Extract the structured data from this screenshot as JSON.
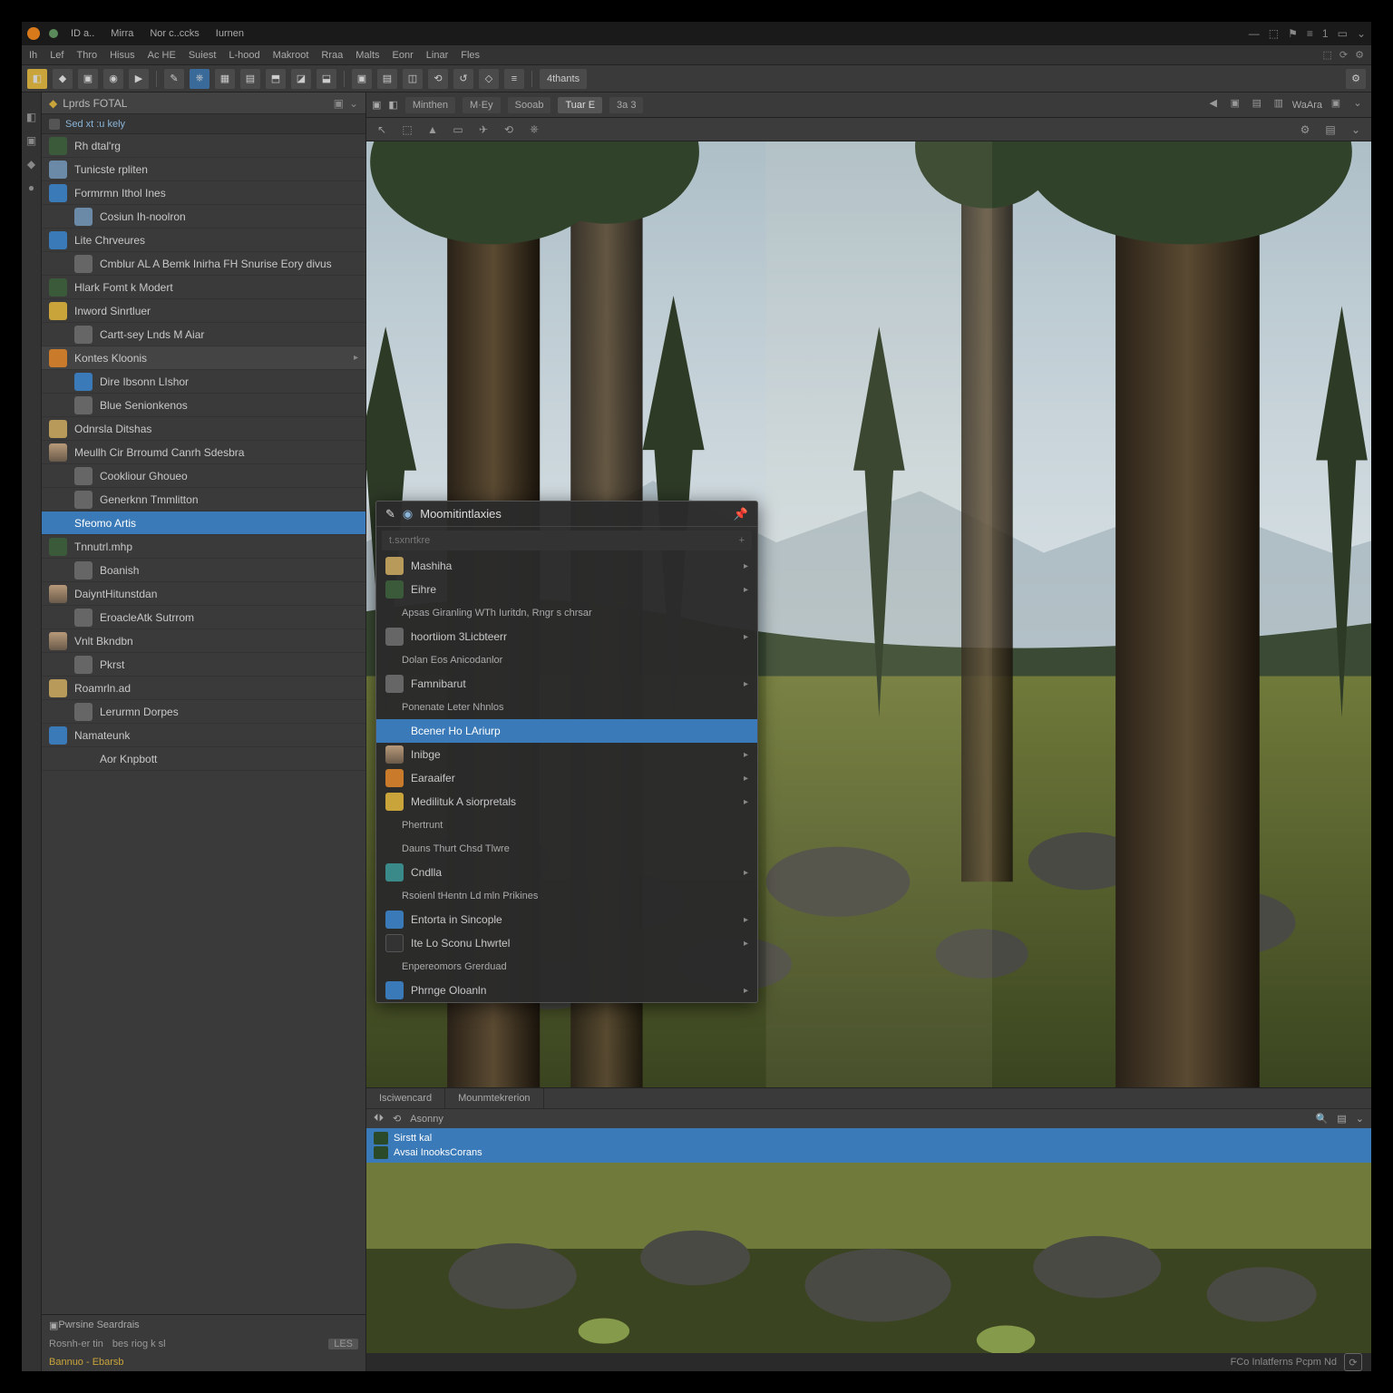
{
  "title": {
    "items": [
      "ID a..",
      "Mirra",
      "Nor c..ccks",
      "Iurnen"
    ],
    "right": [
      "—",
      "⬚",
      "⚑",
      "≡",
      "1",
      "▭",
      "⌄"
    ]
  },
  "menu": {
    "items": [
      "Ih",
      "Lef",
      "Thro",
      "Hisus",
      "Ac HE",
      "Suiest",
      "L-hood",
      "Makroot",
      "Rraa",
      "Malts",
      "Eonr",
      "Linar",
      "Fles"
    ],
    "right": [
      "⬚",
      "⟳",
      "⚙"
    ]
  },
  "toolbar": {
    "buttons": [
      "◧",
      "◆",
      "▣",
      "◉",
      "▶",
      "✎",
      "⎈",
      "▦",
      "▤",
      "⬒",
      "◪",
      "⬓",
      "▣",
      "▤",
      "◫",
      "⟲",
      "↺",
      "◇",
      "≡",
      "◧"
    ],
    "label": "4thants"
  },
  "sidepanel": {
    "title": "Lprds FOTAL",
    "sub": "Sed xt :u   kely",
    "items": [
      {
        "label": "Rh dtal'rg",
        "ico": "c-forest"
      },
      {
        "label": "Tunicste rpliten",
        "ico": "c-sky"
      },
      {
        "label": "Formrmn Ithol Ines",
        "ico": "c-blue"
      },
      {
        "label": "Cosiun Ih-noolron",
        "ico": "c-sky",
        "sub": true
      },
      {
        "label": "Lite Chrveures",
        "ico": "c-blue"
      },
      {
        "label": "Cmblur  AL A Bemk  Inirha FH Snurise Eory divus",
        "ico": "c-grey",
        "sub": true
      },
      {
        "label": "Hlark Fomt k Modert",
        "ico": "c-forest"
      },
      {
        "label": "Inword Sinrtluer",
        "ico": "c-yellow"
      },
      {
        "label": "Cartt-sey Lnds M Aiar",
        "ico": "c-grey",
        "sub": true
      },
      {
        "label": "Kontes Kloonis",
        "ico": "c-orange",
        "header": true
      },
      {
        "label": "Dire  Ibsonn LIshor",
        "ico": "c-blue",
        "sub": true
      },
      {
        "label": "Blue  Senionkenos",
        "ico": "c-grey",
        "sub": true
      },
      {
        "label": "Odnrsla Ditshas",
        "ico": "c-sand"
      },
      {
        "label": "Meullh Cir Brroumd Canrh Sdesbra",
        "ico": "c-portrait"
      },
      {
        "label": "Cookliour Ghoueo",
        "ico": "c-grey",
        "sub": true
      },
      {
        "label": "Generknn Tmmlitton",
        "ico": "c-grey",
        "sub": true
      },
      {
        "label": "Sfeomo Artis",
        "ico": "c-blue",
        "sel": true
      },
      {
        "label": "Tnnutrl.mhp",
        "ico": "c-forest"
      },
      {
        "label": "Boanish",
        "ico": "c-grey",
        "sub": true
      },
      {
        "label": "DaiyntHitunstdan",
        "ico": "c-portrait"
      },
      {
        "label": "EroacleAtk Sutrrom",
        "ico": "c-grey",
        "sub": true
      },
      {
        "label": "Vnlt Bkndbn",
        "ico": "c-portrait"
      },
      {
        "label": "Pkrst",
        "ico": "c-grey",
        "sub": true
      },
      {
        "label": "Roamrln.ad",
        "ico": "c-sand"
      },
      {
        "label": "Lerurmn  Dorpes",
        "ico": "c-grey",
        "sub": true
      },
      {
        "label": "Namateunk",
        "ico": "c-blue"
      },
      {
        "label": "Aor  Knpbott",
        "ico": "",
        "sub": true
      }
    ],
    "footer": {
      "title": "Pwrsine Seardrais",
      "row": [
        "Rosnh-er   tin",
        "bes riog k sl"
      ],
      "count": "LES",
      "status": "Bannuo - Ebarsb"
    }
  },
  "viewport": {
    "tabs": [
      "Minthen",
      "M·Ey",
      "Sooab",
      "Tuar E",
      "3a 3"
    ],
    "right_label": "WaAra"
  },
  "popup": {
    "title": "Moomitintlaxies",
    "search": "t.sxnrtkre",
    "items": [
      {
        "label": "Mashiha",
        "ico": "c-sand"
      },
      {
        "label": "Eihre",
        "ico": "c-forest"
      },
      {
        "label": "Apsas Giranling  WTh Iuritdn, Rngr s chrsar",
        "sub": true
      },
      {
        "label": "hoortiiom 3Licbteerr",
        "ico": "c-grey"
      },
      {
        "label": "Dolan Eos Anicodanlor",
        "sub": true
      },
      {
        "label": "Famnibarut",
        "ico": "c-grey"
      },
      {
        "label": "Ponenate Leter Nhnlos",
        "sub": true
      },
      {
        "label": "Bcener  Ho LAriurp",
        "ico": "c-blue",
        "sel": true
      },
      {
        "label": "Inibge",
        "ico": "c-portrait"
      },
      {
        "label": "Earaaifer",
        "ico": "c-orange"
      },
      {
        "label": "Medilituk  A siorpretals",
        "ico": "c-yellow"
      },
      {
        "label": "Phertrunt",
        "sub": true
      },
      {
        "label": "Dauns  Thurt Chsd Tlwre",
        "sub": true
      },
      {
        "label": "Cndlla",
        "ico": "c-teal"
      },
      {
        "label": "Rsoienl tHentn Ld mln Prikines",
        "sub": true
      },
      {
        "label": "Entorta in Sincople",
        "ico": "c-blue"
      },
      {
        "label": "Ite Lo Sconu Lhwrtel",
        "ico": "c-dark"
      },
      {
        "label": "Enpereomors  Grerduad",
        "sub": true
      },
      {
        "label": "Phrnge Oloanln",
        "ico": "c-blue"
      }
    ]
  },
  "dock": {
    "tabs": [
      "Isciwencard",
      "Mounmtekrerion"
    ],
    "bar": "Asonny",
    "sel1": "Sirstt kal",
    "sel2": "Avsai  InooksCorans"
  },
  "status": {
    "text": "FCo Inlatferns Pcpm Nd "
  }
}
